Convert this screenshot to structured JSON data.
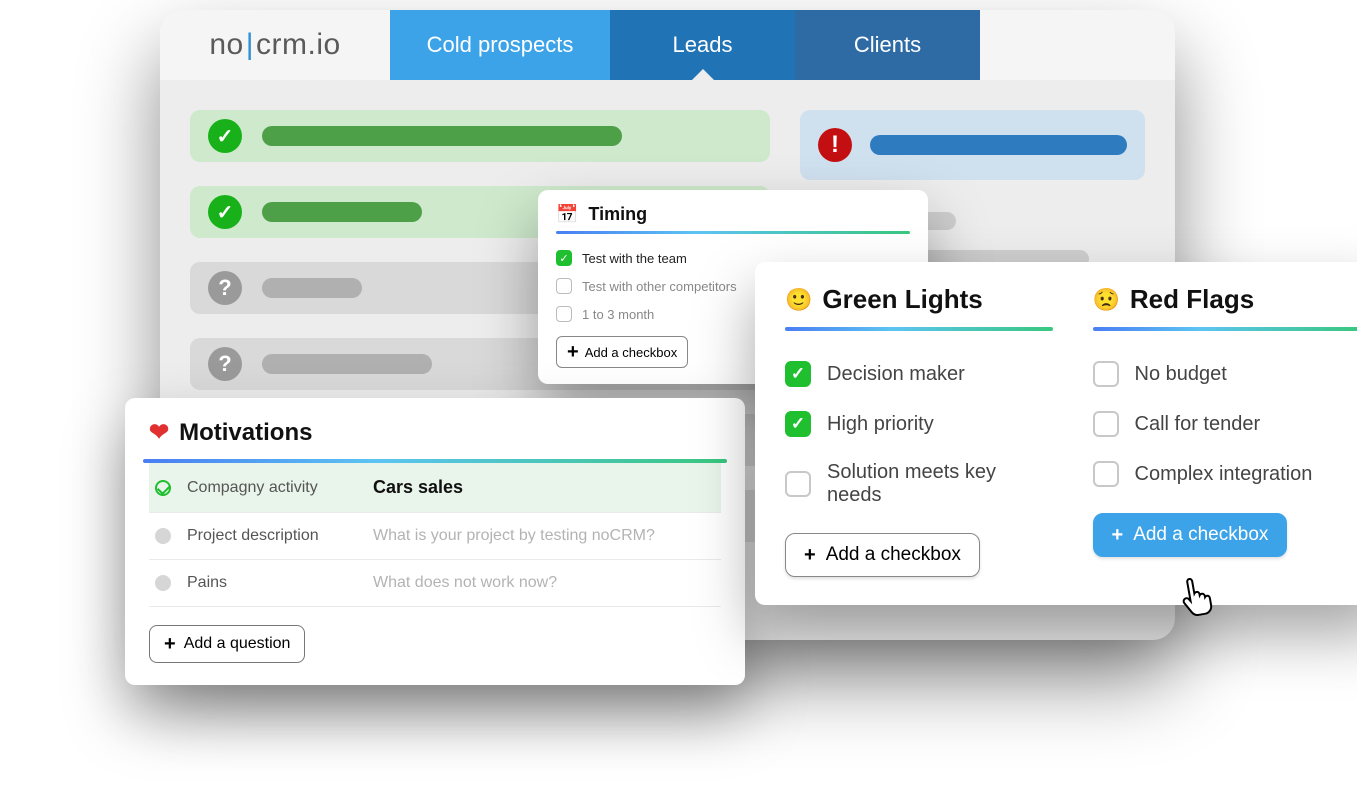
{
  "brand": {
    "part1": "no",
    "part2": "crm",
    "part3": ".io"
  },
  "tabs": {
    "cold": "Cold prospects",
    "leads": "Leads",
    "clients": "Clients"
  },
  "timing": {
    "title": "Timing",
    "items": [
      "Test with the team",
      "Test with other competitors",
      "1 to 3 month"
    ],
    "add": "Add a checkbox"
  },
  "motivations": {
    "title": "Motivations",
    "rows": [
      {
        "label": "Compagny activity",
        "value": "Cars sales"
      },
      {
        "label": "Project description",
        "placeholder": "What is your project by testing noCRM?"
      },
      {
        "label": "Pains",
        "placeholder": "What does not work now?"
      }
    ],
    "add": "Add a question"
  },
  "lights": {
    "green": {
      "title": "Green Lights",
      "items": [
        "Decision maker",
        "High priority",
        "Solution meets key needs"
      ],
      "add": "Add a checkbox"
    },
    "red": {
      "title": "Red Flags",
      "items": [
        "No budget",
        "Call for tender",
        "Complex integration"
      ],
      "add": "Add a checkbox"
    }
  }
}
